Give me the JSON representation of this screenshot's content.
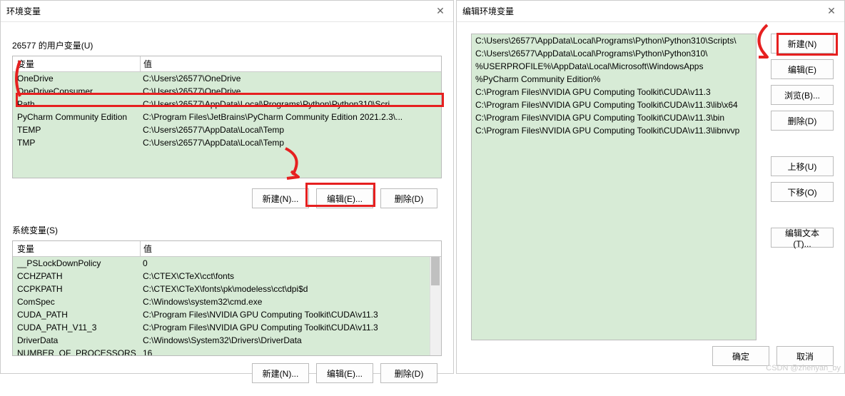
{
  "left_dialog": {
    "title": "环境变量",
    "user_section_label": "26577 的用户变量(U)",
    "sys_section_label": "系统变量(S)",
    "header_var": "变量",
    "header_val": "值",
    "btn_new": "新建(N)...",
    "btn_edit": "编辑(E)...",
    "btn_delete": "删除(D)",
    "user_vars": [
      {
        "name": "OneDrive",
        "value": "C:\\Users\\26577\\OneDrive"
      },
      {
        "name": "OneDriveConsumer",
        "value": "C:\\Users\\26577\\OneDrive"
      },
      {
        "name": "Path",
        "value": "C:\\Users\\26577\\AppData\\Local\\Programs\\Python\\Python310\\Scri..."
      },
      {
        "name": "PyCharm Community Edition",
        "value": "C:\\Program Files\\JetBrains\\PyCharm Community Edition 2021.2.3\\..."
      },
      {
        "name": "TEMP",
        "value": "C:\\Users\\26577\\AppData\\Local\\Temp"
      },
      {
        "name": "TMP",
        "value": "C:\\Users\\26577\\AppData\\Local\\Temp"
      }
    ],
    "sys_vars": [
      {
        "name": "__PSLockDownPolicy",
        "value": "0"
      },
      {
        "name": "CCHZPATH",
        "value": "C:\\CTEX\\CTeX\\cct\\fonts"
      },
      {
        "name": "CCPKPATH",
        "value": "C:\\CTEX\\CTeX\\fonts\\pk\\modeless\\cct\\dpi$d"
      },
      {
        "name": "ComSpec",
        "value": "C:\\Windows\\system32\\cmd.exe"
      },
      {
        "name": "CUDA_PATH",
        "value": "C:\\Program Files\\NVIDIA GPU Computing Toolkit\\CUDA\\v11.3"
      },
      {
        "name": "CUDA_PATH_V11_3",
        "value": "C:\\Program Files\\NVIDIA GPU Computing Toolkit\\CUDA\\v11.3"
      },
      {
        "name": "DriverData",
        "value": "C:\\Windows\\System32\\Drivers\\DriverData"
      },
      {
        "name": "NUMBER_OF_PROCESSORS",
        "value": "16"
      }
    ]
  },
  "right_dialog": {
    "title": "编辑环境变量",
    "path_entries": [
      "C:\\Users\\26577\\AppData\\Local\\Programs\\Python\\Python310\\Scripts\\",
      "C:\\Users\\26577\\AppData\\Local\\Programs\\Python\\Python310\\",
      "%USERPROFILE%\\AppData\\Local\\Microsoft\\WindowsApps",
      "%PyCharm Community Edition%",
      "C:\\Program Files\\NVIDIA GPU Computing Toolkit\\CUDA\\v11.3",
      "C:\\Program Files\\NVIDIA GPU Computing Toolkit\\CUDA\\v11.3\\lib\\x64",
      "C:\\Program Files\\NVIDIA GPU Computing Toolkit\\CUDA\\v11.3\\bin",
      "C:\\Program Files\\NVIDIA GPU Computing Toolkit\\CUDA\\v11.3\\libnvvp"
    ],
    "btn_new": "新建(N)",
    "btn_edit": "编辑(E)",
    "btn_browse": "浏览(B)...",
    "btn_delete": "删除(D)",
    "btn_up": "上移(U)",
    "btn_down": "下移(O)",
    "btn_edit_text": "编辑文本(T)...",
    "btn_ok": "确定",
    "btn_cancel": "取消"
  },
  "watermark": "CSDN @zhenyan_by"
}
